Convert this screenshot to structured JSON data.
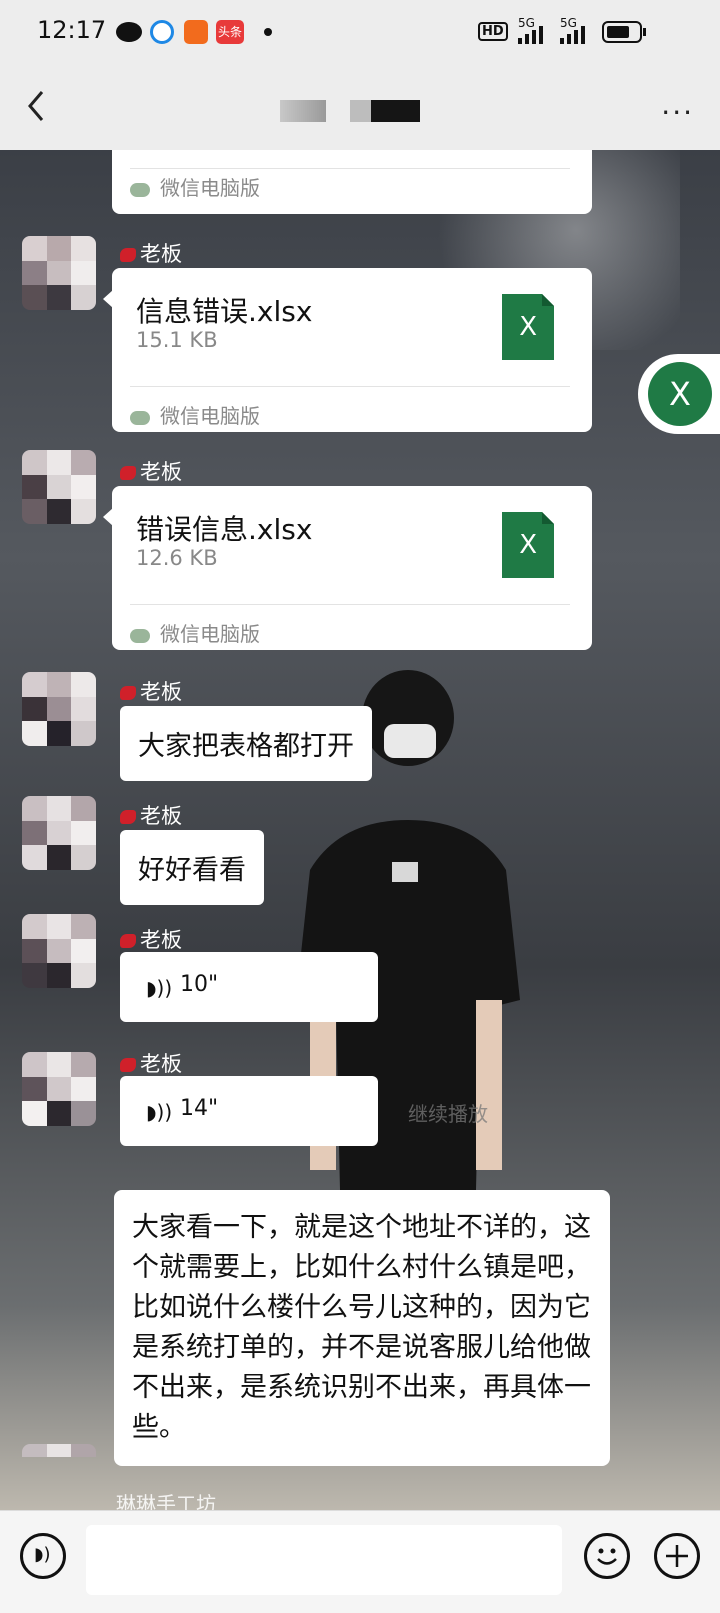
{
  "status": {
    "time": "12:17",
    "badge": "头条",
    "net1": "5G",
    "net2": "5G",
    "hd": "HD"
  },
  "nav": {
    "more": "···"
  },
  "float_button": {
    "label": "X"
  },
  "messages": [
    {
      "type": "file_tail",
      "source": "微信电脑版"
    },
    {
      "type": "file",
      "sender": "老板",
      "name": "信息错误.xlsx",
      "size": "15.1 KB",
      "icon": "X",
      "source": "微信电脑版"
    },
    {
      "type": "file",
      "sender": "老板",
      "name": "错误信息.xlsx",
      "size": "12.6 KB",
      "icon": "X",
      "source": "微信电脑版"
    },
    {
      "type": "text",
      "sender": "老板",
      "text": "大家把表格都打开"
    },
    {
      "type": "text",
      "sender": "老板",
      "text": "好好看看"
    },
    {
      "type": "voice",
      "sender": "老板",
      "duration": "10\""
    },
    {
      "type": "voice",
      "sender": "老板",
      "duration": "14\""
    },
    {
      "type": "transcript",
      "text": "大家看一下，就是这个地址不详的，这个就需要上，比如什么村什么镇是吧，比如说什么楼什么号儿这种的，因为它是系统打单的，并不是说客服儿给他做不出来，是系统识别不出来，再具体一些。"
    }
  ],
  "overlay": {
    "resume_label": "继续播放"
  },
  "next_sender": "琳琳手工坊",
  "colors": {
    "excel": "#1f7a45",
    "chat_bg": "#3b3f46",
    "bar_bg": "#ededed"
  }
}
